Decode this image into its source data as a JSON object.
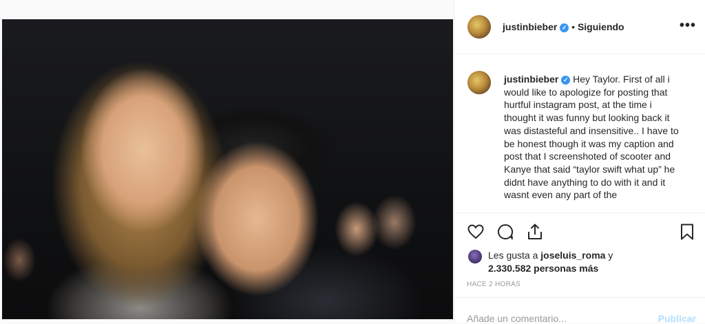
{
  "post": {
    "username": "justinbieber",
    "follow_separator": "•",
    "follow_status": "Siguiendo",
    "more_label": "•••",
    "caption_text": "Hey Taylor. First of all i would like to apologize for posting that hurtful instagram post, at the time i thought it was funny but looking back it was distasteful and insensitive.. I have to be honest though it was my caption and post that I screenshoted of scooter and Kanye that said “taylor swift what up” he didnt have anything to do with it and it wasnt even any part of the",
    "likes_prefix": "Les gusta a",
    "likes_user": "joseluis_roma",
    "likes_conj": "y",
    "likes_count": "2.330.582 personas más",
    "timestamp": "HACE 2 HORAS",
    "comment_placeholder": "Añade un comentario...",
    "publish_label": "Publicar"
  },
  "icons": {
    "verified": "verified-badge-icon",
    "like": "heart-icon",
    "comment": "comment-bubble-icon",
    "share": "share-icon",
    "save": "bookmark-icon"
  },
  "colors": {
    "verified": "#3897f0",
    "publish": "#b2dffc",
    "secondary": "#999999"
  }
}
